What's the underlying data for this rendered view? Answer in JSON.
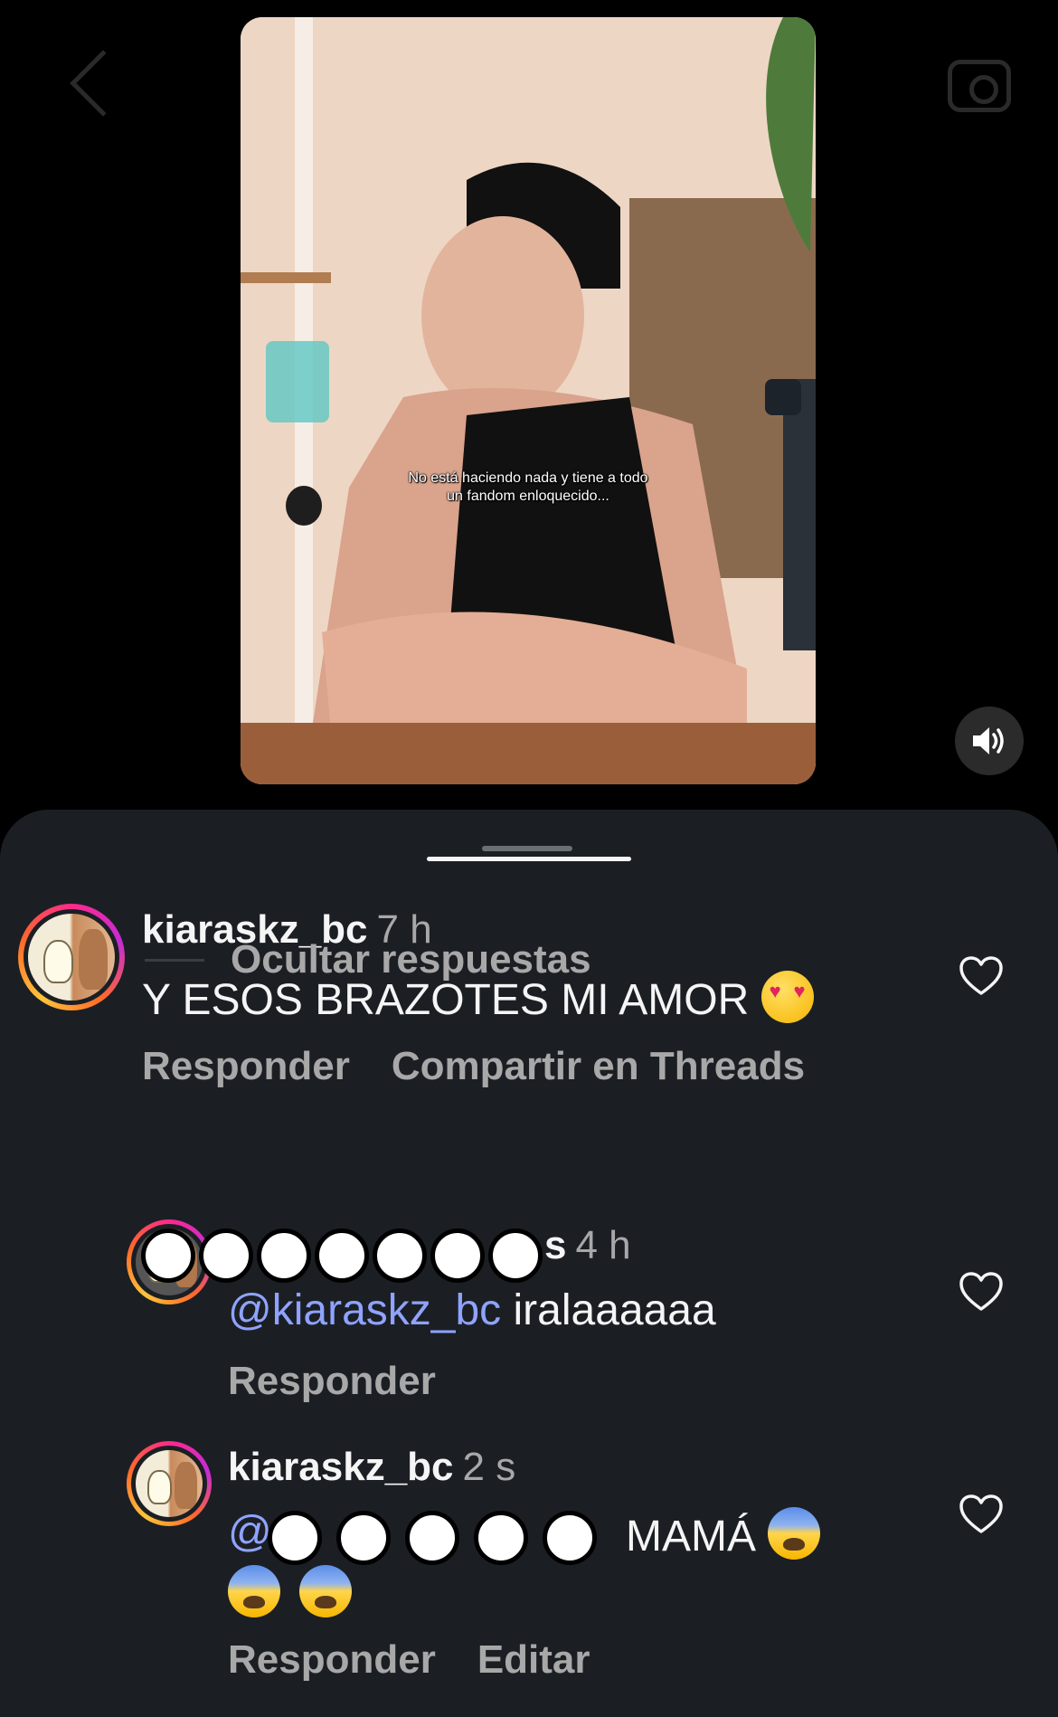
{
  "video": {
    "subtitle_line1": "No está haciendo nada y tiene a todo",
    "subtitle_line2": "un fandom enloquecido..."
  },
  "comments": [
    {
      "username": "kiaraskz_bc",
      "time": "7 h",
      "text": "Y ESOS BRAZOTES MI AMOR",
      "emoji": "smiling-face-with-heart-eyes",
      "actions": [
        "Responder",
        "Compartir en Threads"
      ]
    }
  ],
  "hide_replies_label": "Ocultar respuestas",
  "replies": [
    {
      "username_partial": "s",
      "time": "4 h",
      "mention": "@kiaraskz_bc",
      "text": "iralaaaaaa",
      "actions": [
        "Responder"
      ]
    },
    {
      "username": "kiaraskz_bc",
      "time": "2 s",
      "mention": "@",
      "text": "MAMÁ",
      "emoji": "fearful-face",
      "actions": [
        "Responder",
        "Editar"
      ]
    }
  ],
  "colors": {
    "sheet_bg": "#1b1f24",
    "mention": "#8fa3ff",
    "muted": "#a8a8a8"
  }
}
